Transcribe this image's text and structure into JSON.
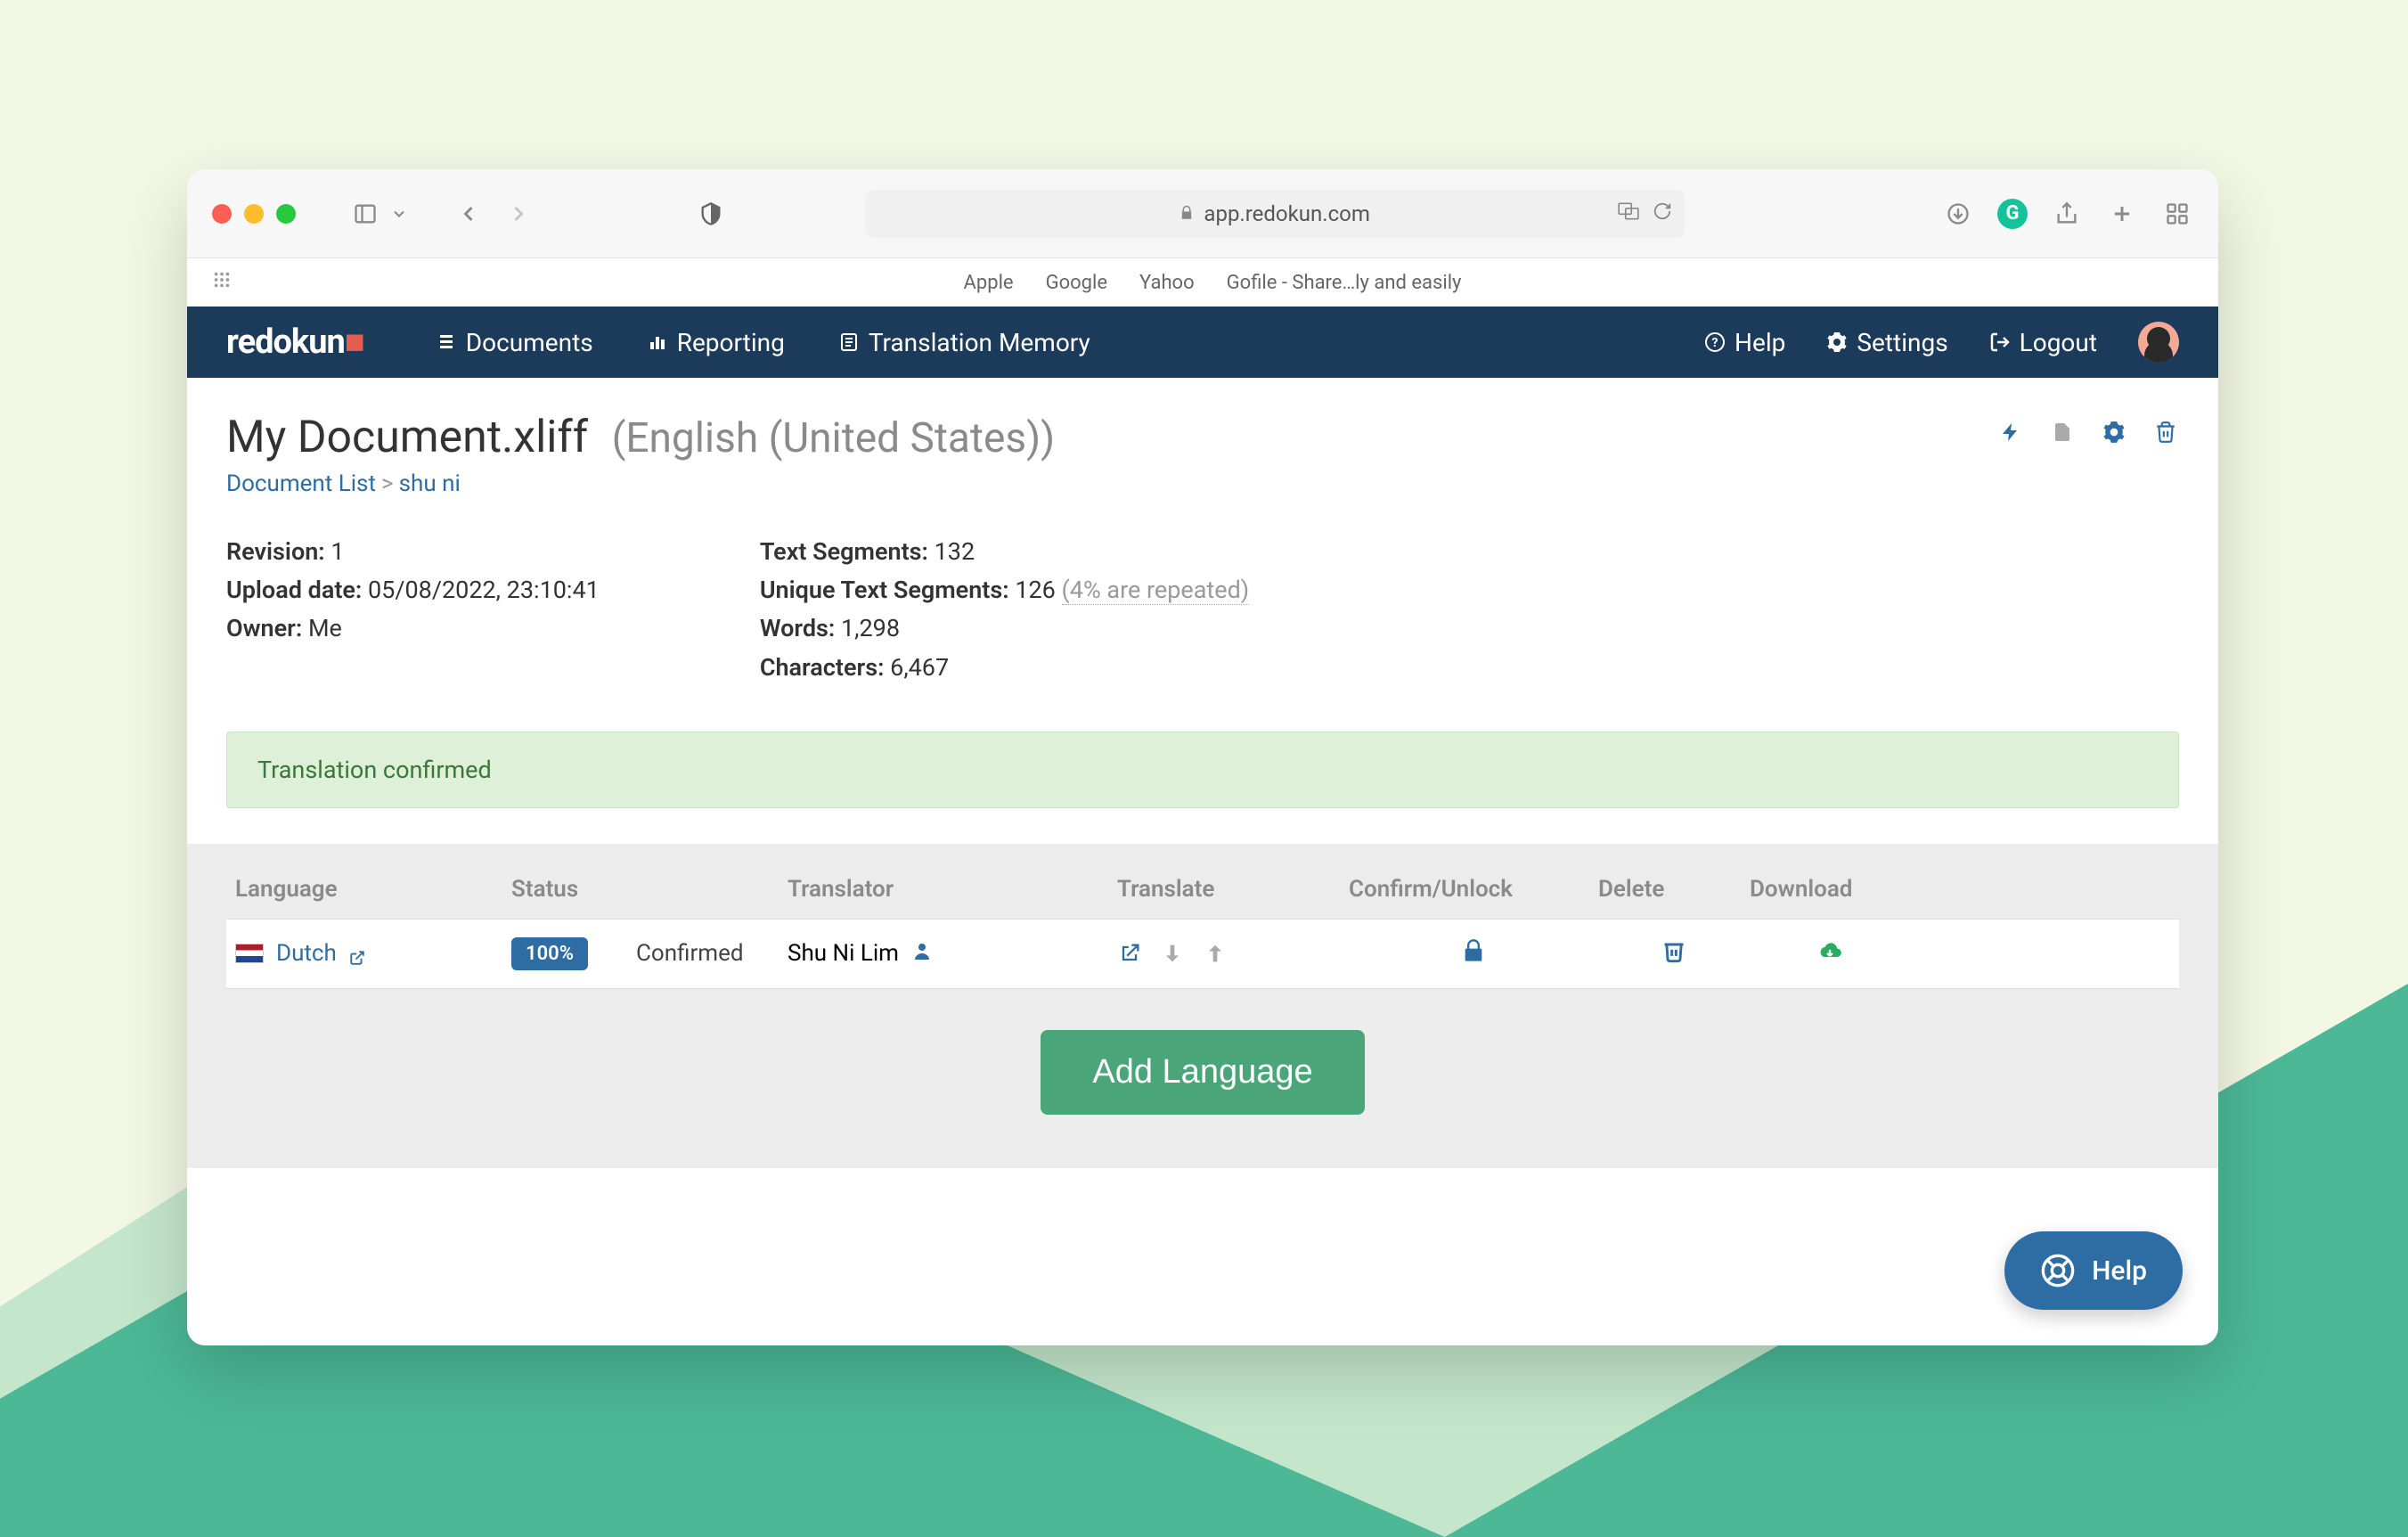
{
  "safari": {
    "url": "app.redokun.com",
    "bookmarks": [
      "Apple",
      "Google",
      "Yahoo",
      "Gofile - Share…ly and easily"
    ]
  },
  "app": {
    "logo": "redokun",
    "nav": {
      "documents": "Documents",
      "reporting": "Reporting",
      "translation_memory": "Translation Memory"
    },
    "nav_right": {
      "help": "Help",
      "settings": "Settings",
      "logout": "Logout"
    }
  },
  "page": {
    "title": "My Document.xliff",
    "title_lang": "(English (United States))",
    "breadcrumb": {
      "root": "Document List",
      "current": "shu ni"
    },
    "meta_left": {
      "revision_label": "Revision:",
      "revision_value": "1",
      "upload_label": "Upload date:",
      "upload_value": "05/08/2022, 23:10:41",
      "owner_label": "Owner:",
      "owner_value": "Me"
    },
    "meta_right": {
      "text_segments_label": "Text Segments:",
      "text_segments_value": "132",
      "unique_label": "Unique Text Segments:",
      "unique_value": "126",
      "unique_hint": "(4% are repeated)",
      "words_label": "Words:",
      "words_value": "1,298",
      "chars_label": "Characters:",
      "chars_value": "6,467"
    },
    "banner": "Translation confirmed"
  },
  "table": {
    "headers": {
      "language": "Language",
      "status": "Status",
      "translator": "Translator",
      "translate": "Translate",
      "confirm": "Confirm/Unlock",
      "delete": "Delete",
      "download": "Download"
    },
    "row": {
      "language": "Dutch",
      "status_badge": "100%",
      "status_text": "Confirmed",
      "translator": "Shu Ni Lim"
    },
    "add_lang": "Add Language"
  },
  "help_bubble": "Help"
}
